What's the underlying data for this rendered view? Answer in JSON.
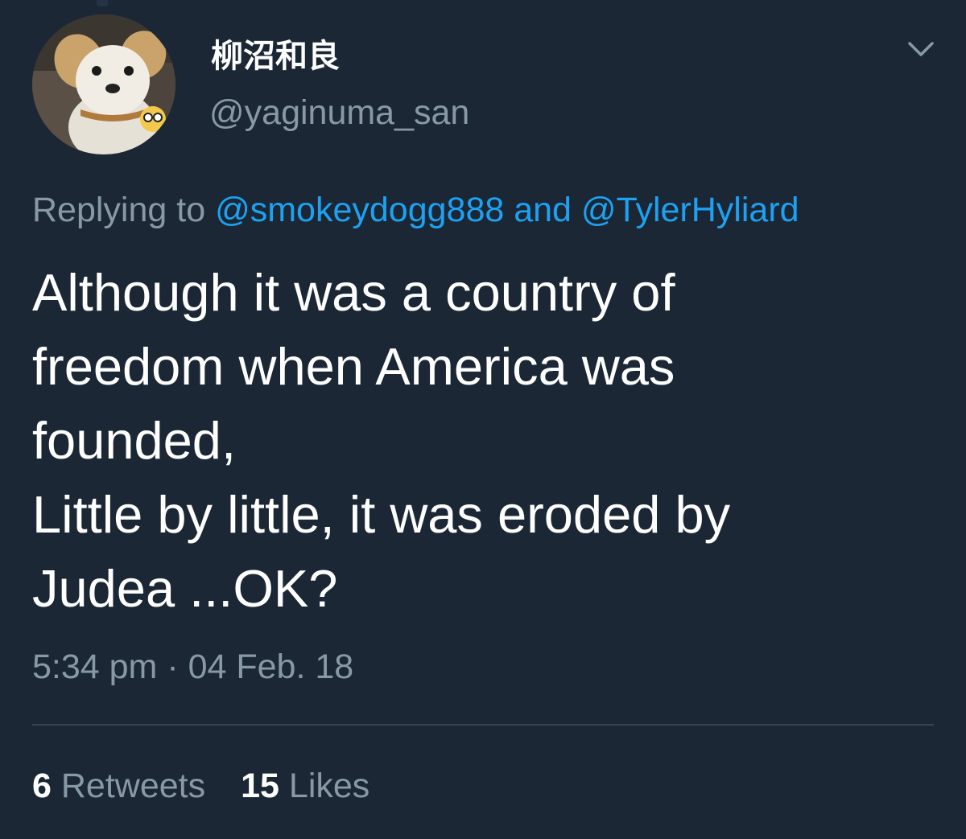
{
  "user": {
    "display_name": "柳沼和良",
    "handle": "@yaginuma_san",
    "avatar_icon": "plush-dog-avatar"
  },
  "menu_icon": "chevron-down-icon",
  "reply": {
    "prefix": "Replying to ",
    "mention_1": "@smokeydogg888",
    "conjunction": " and ",
    "mention_2": "@TylerHyliard"
  },
  "tweet": {
    "lines": [
      "Although it was a country of",
      "freedom when America was",
      "founded,",
      "Little by little, it was eroded by",
      "Judea ...OK?"
    ]
  },
  "timestamp": "5:34 pm · 04 Feb. 18",
  "stats": {
    "retweets_count": "6",
    "retweets_label": "Retweets",
    "likes_count": "15",
    "likes_label": "Likes"
  },
  "colors": {
    "background": "#1b2735",
    "text": "#ffffff",
    "secondary": "#8899a6",
    "link": "#1da1f2",
    "divider": "#38444d"
  }
}
